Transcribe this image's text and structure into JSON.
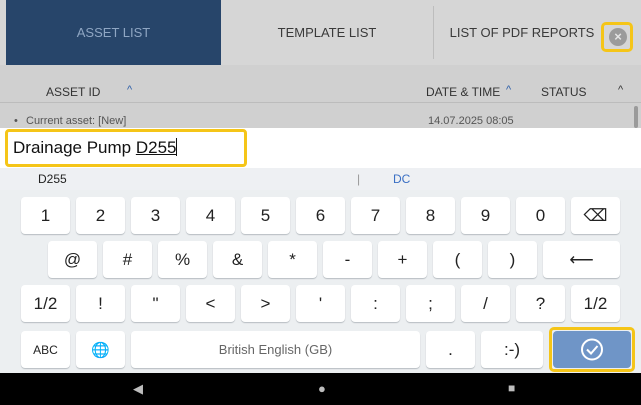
{
  "tabs": [
    {
      "label": "ASSET LIST"
    },
    {
      "label": "TEMPLATE LIST"
    },
    {
      "label": "LIST OF PDF REPORTS"
    }
  ],
  "list_header": {
    "asset_id": "ASSET ID",
    "sort_up": "^",
    "date_time": "DATE & TIME",
    "status": "STATUS",
    "collapse": "^"
  },
  "partial_row": {
    "label": "Current asset: [New]",
    "date": "14.07.2025 08:05"
  },
  "input": {
    "text_prefix": "Drainage Pump ",
    "text_composing": "D255"
  },
  "suggestions": {
    "left": "D255",
    "separator": "|",
    "right": "DC"
  },
  "keyboard": {
    "row1": [
      "1",
      "2",
      "3",
      "4",
      "5",
      "6",
      "7",
      "8",
      "9",
      "0"
    ],
    "backspace": "⌫",
    "row2": [
      "@",
      "#",
      "%",
      "&",
      "*",
      "-",
      "+",
      "(",
      ")"
    ],
    "enter_symbol": "⟵",
    "row3_left": "1/2",
    "row3": [
      "!",
      "\"",
      "<",
      ">",
      "'",
      ":",
      ";",
      "/",
      "?"
    ],
    "row3_right": "1/2",
    "abc": "ABC",
    "globe": "🌐",
    "space": "British English (GB)",
    "period": ".",
    "emoticon": ":-)",
    "done": "✓"
  },
  "navbar": {
    "back": "◀",
    "home": "●",
    "recents": "■"
  },
  "colors": {
    "active_tab": "#27456a",
    "highlight": "#f5c518",
    "done_key": "#6f95c7"
  }
}
